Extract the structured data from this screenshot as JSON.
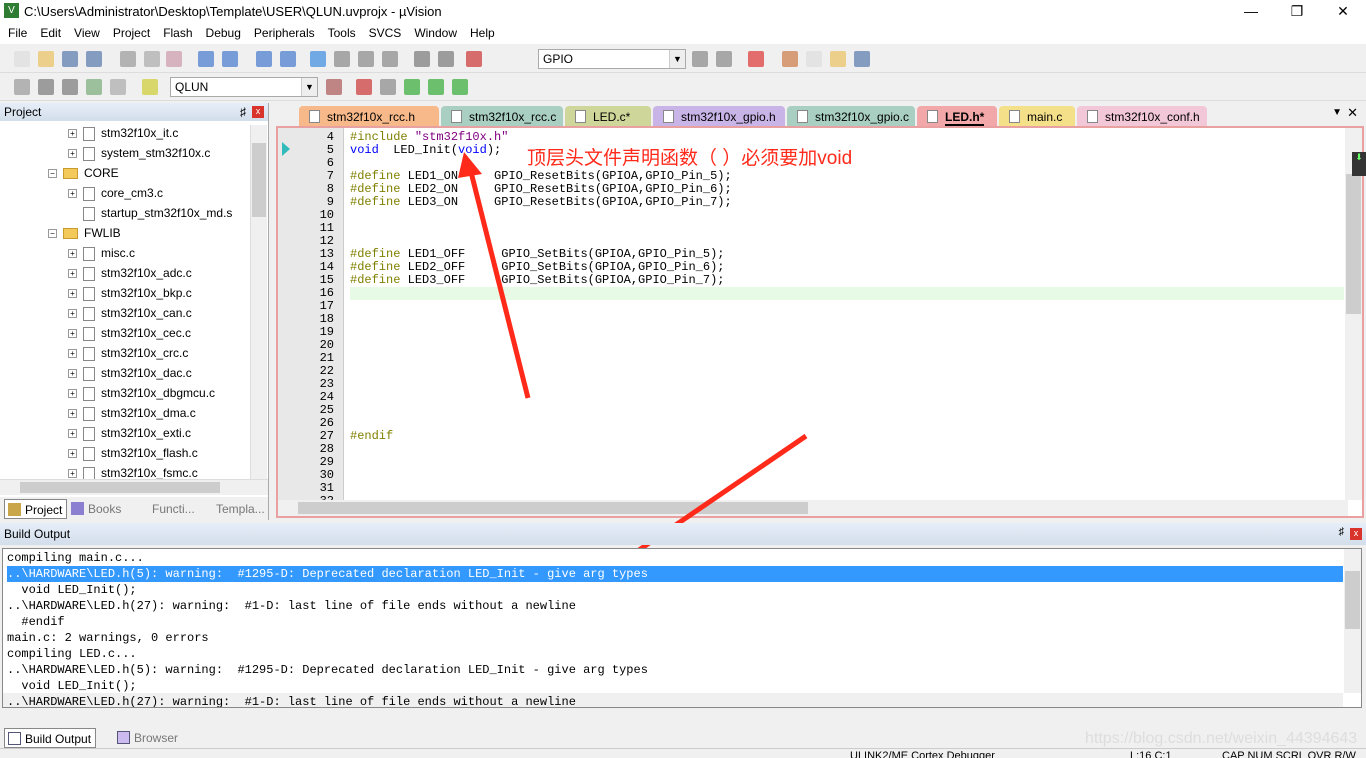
{
  "window": {
    "title": "C:\\Users\\Administrator\\Desktop\\Template\\USER\\QLUN.uvprojx - µVision",
    "min": "—",
    "max": "❐",
    "close": "✕"
  },
  "menu": [
    "File",
    "Edit",
    "View",
    "Project",
    "Flash",
    "Debug",
    "Peripherals",
    "Tools",
    "SVCS",
    "Window",
    "Help"
  ],
  "toolbar": {
    "find_combo": "GPIO",
    "target_combo": "QLUN"
  },
  "project": {
    "title": "Project",
    "pin": "♯",
    "close": "x",
    "items": [
      {
        "label": "stm32f10x_it.c",
        "type": "file",
        "level": 2,
        "exp": "+"
      },
      {
        "label": "system_stm32f10x.c",
        "type": "file",
        "level": 2,
        "exp": "+"
      },
      {
        "label": "CORE",
        "type": "folder",
        "level": 1,
        "exp": "−"
      },
      {
        "label": "core_cm3.c",
        "type": "file",
        "level": 2,
        "exp": "+"
      },
      {
        "label": "startup_stm32f10x_md.s",
        "type": "file",
        "level": 2,
        "exp": ""
      },
      {
        "label": "FWLIB",
        "type": "folder",
        "level": 1,
        "exp": "−"
      },
      {
        "label": "misc.c",
        "type": "file",
        "level": 2,
        "exp": "+"
      },
      {
        "label": "stm32f10x_adc.c",
        "type": "file",
        "level": 2,
        "exp": "+"
      },
      {
        "label": "stm32f10x_bkp.c",
        "type": "file",
        "level": 2,
        "exp": "+"
      },
      {
        "label": "stm32f10x_can.c",
        "type": "file",
        "level": 2,
        "exp": "+"
      },
      {
        "label": "stm32f10x_cec.c",
        "type": "file",
        "level": 2,
        "exp": "+"
      },
      {
        "label": "stm32f10x_crc.c",
        "type": "file",
        "level": 2,
        "exp": "+"
      },
      {
        "label": "stm32f10x_dac.c",
        "type": "file",
        "level": 2,
        "exp": "+"
      },
      {
        "label": "stm32f10x_dbgmcu.c",
        "type": "file",
        "level": 2,
        "exp": "+"
      },
      {
        "label": "stm32f10x_dma.c",
        "type": "file",
        "level": 2,
        "exp": "+"
      },
      {
        "label": "stm32f10x_exti.c",
        "type": "file",
        "level": 2,
        "exp": "+"
      },
      {
        "label": "stm32f10x_flash.c",
        "type": "file",
        "level": 2,
        "exp": "+"
      },
      {
        "label": "stm32f10x_fsmc.c",
        "type": "file",
        "level": 2,
        "exp": "+"
      }
    ],
    "tabs": [
      "Project",
      "Books",
      "Functi...",
      "Templa..."
    ]
  },
  "editor": {
    "tabs": [
      {
        "label": "stm32f10x_rcc.h",
        "color": "#f7b98a"
      },
      {
        "label": "stm32f10x_rcc.c",
        "color": "#a9cfc3"
      },
      {
        "label": "LED.c*",
        "color": "#cfd69a"
      },
      {
        "label": "stm32f10x_gpio.h",
        "color": "#c8b4e6"
      },
      {
        "label": "stm32f10x_gpio.c",
        "color": "#a9cfc3"
      },
      {
        "label": "LED.h*",
        "color": "#f2a8a8",
        "active": true
      },
      {
        "label": "main.c",
        "color": "#f5e08a"
      },
      {
        "label": "stm32f10x_conf.h",
        "color": "#f2c8d8"
      }
    ],
    "lines": [
      {
        "n": "4",
        "code": [
          [
            "pp",
            "#include "
          ],
          [
            "str",
            "\"stm32f10x.h\""
          ]
        ]
      },
      {
        "n": "5",
        "code": [
          [
            "kw",
            "void"
          ],
          [
            "",
            "  LED_Init("
          ],
          [
            "kw",
            "void"
          ],
          [
            "",
            ");"
          ]
        ]
      },
      {
        "n": "6",
        "code": []
      },
      {
        "n": "7",
        "code": [
          [
            "pp",
            "#define"
          ],
          [
            "",
            " LED1_ON     GPIO_ResetBits(GPIOA,GPIO_Pin_5);"
          ]
        ]
      },
      {
        "n": "8",
        "code": [
          [
            "pp",
            "#define"
          ],
          [
            "",
            " LED2_ON     GPIO_ResetBits(GPIOA,GPIO_Pin_6);"
          ]
        ]
      },
      {
        "n": "9",
        "code": [
          [
            "pp",
            "#define"
          ],
          [
            "",
            " LED3_ON     GPIO_ResetBits(GPIOA,GPIO_Pin_7);"
          ]
        ]
      },
      {
        "n": "10",
        "code": []
      },
      {
        "n": "11",
        "code": []
      },
      {
        "n": "12",
        "code": []
      },
      {
        "n": "13",
        "code": [
          [
            "pp",
            "#define"
          ],
          [
            "",
            " LED1_OFF     GPIO_SetBits(GPIOA,GPIO_Pin_5);"
          ]
        ]
      },
      {
        "n": "14",
        "code": [
          [
            "pp",
            "#define"
          ],
          [
            "",
            " LED2_OFF     GPIO_SetBits(GPIOA,GPIO_Pin_6);"
          ]
        ]
      },
      {
        "n": "15",
        "code": [
          [
            "pp",
            "#define"
          ],
          [
            "",
            " LED3_OFF     GPIO_SetBits(GPIOA,GPIO_Pin_7);"
          ]
        ]
      },
      {
        "n": "16",
        "code": [],
        "current": true
      },
      {
        "n": "17",
        "code": []
      },
      {
        "n": "18",
        "code": []
      },
      {
        "n": "19",
        "code": []
      },
      {
        "n": "20",
        "code": []
      },
      {
        "n": "21",
        "code": []
      },
      {
        "n": "22",
        "code": []
      },
      {
        "n": "23",
        "code": []
      },
      {
        "n": "24",
        "code": []
      },
      {
        "n": "25",
        "code": []
      },
      {
        "n": "26",
        "code": []
      },
      {
        "n": "27",
        "code": [
          [
            "pp",
            "#endif"
          ]
        ]
      },
      {
        "n": "28",
        "code": []
      },
      {
        "n": "29",
        "code": []
      },
      {
        "n": "30",
        "code": []
      },
      {
        "n": "31",
        "code": []
      },
      {
        "n": "32",
        "code": []
      }
    ]
  },
  "annotation": "顶层头文件声明函数（ ）必须要加void",
  "build": {
    "title": "Build Output",
    "lines": [
      "compiling main.c...",
      "..\\HARDWARE\\LED.h(5): warning:  #1295-D: Deprecated declaration LED_Init - give arg types",
      "  void LED_Init();",
      "..\\HARDWARE\\LED.h(27): warning:  #1-D: last line of file ends without a newline",
      "  #endif",
      "main.c: 2 warnings, 0 errors",
      "compiling LED.c...",
      "..\\HARDWARE\\LED.h(5): warning:  #1295-D: Deprecated declaration LED_Init - give arg types",
      "  void LED_Init();",
      "..\\HARDWARE\\LED.h(27): warning:  #1-D: last line of file ends without a newline"
    ],
    "selected": 1,
    "tabs": [
      "Build Output",
      "Browser"
    ]
  },
  "watermark": "https://blog.csdn.net/weixin_44394643",
  "status": {
    "debugger": "ULINK2/ME Cortex Debugger",
    "pos": "L:16 C:1",
    "flags": "CAP  NUM  SCRL  OVR  R/W"
  },
  "colors": {
    "accent": "#3399ff",
    "annotation": "#ff2a1a",
    "current_line": "#e6fae6"
  }
}
